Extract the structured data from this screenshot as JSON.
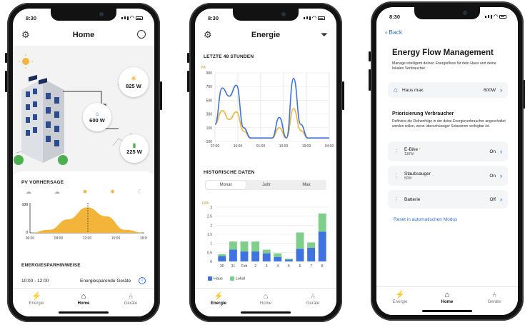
{
  "status_time": "8:30",
  "tabs": {
    "energie": "Energie",
    "home": "Home",
    "geraete": "Geräte"
  },
  "home": {
    "title": "Home",
    "bubbles": {
      "pv": "825 W",
      "house": "600 W",
      "battery": "225 W"
    },
    "pv_title": "PV VORHERSAGE",
    "pv_y_max": "100",
    "pv_y_min": "0",
    "pv_times": [
      "06:00",
      "09:00",
      "12:00",
      "15:00",
      "18:00"
    ],
    "tips_title": "ENERGIESPARHINWEISE",
    "tip_time": "10:00 - 12:00",
    "tip_text": "Energiesparende Geräte"
  },
  "energie": {
    "title": "Energie",
    "last48_title": "LETZTE 48 STUNDEN",
    "unit": "Wh",
    "y_ticks": [
      "900",
      "700",
      "500",
      "300",
      "100",
      "-100"
    ],
    "x_ticks": [
      "07:00",
      "16:00",
      "01:00",
      "10:00",
      "19:00",
      "04:00"
    ],
    "hist_title": "HISTORISCHE DATEN",
    "segments": [
      "Monat",
      "Jahr",
      "Max"
    ],
    "hist_unit": "kWh",
    "hist_y_ticks": [
      "3",
      "2.5",
      "2",
      "1.5",
      "1",
      "0.5",
      "0"
    ],
    "hist_x": [
      "30",
      "31",
      "Feb",
      "2",
      "3",
      "4",
      "5",
      "6",
      "7",
      "8"
    ],
    "legend_haus": "Haus",
    "legend_lokal": "Lokal"
  },
  "efm": {
    "back": "Back",
    "title": "Energy Flow Management",
    "intro": "Manage intelligent deinen Energiefluss für dein Haus und deine lokalen Verbraucher.",
    "haus_label": "Haus max.",
    "haus_value": "600W",
    "prio_title": "Priorisierung Verbraucher",
    "prio_desc": "Definiere die Reihenfolge in der deine Energieverbraucher angeschaltet werden sollen, wenn überschüssiger Solarstrom verfügbar ist.",
    "devices": [
      {
        "name": "E-Bike",
        "sub": "135W",
        "state": "On"
      },
      {
        "name": "Staubsauger",
        "sub": "50W",
        "state": "On"
      },
      {
        "name": "Batterie",
        "sub": "",
        "state": "Off"
      }
    ],
    "reset": "Reset in automatischen Modus"
  },
  "colors": {
    "accent": "#2a6fd6",
    "solar": "#f2b53a",
    "green": "#7fcf8a",
    "blue": "#3f74e0"
  },
  "chart_data": [
    {
      "type": "area",
      "title": "PV VORHERSAGE",
      "x": [
        "06:00",
        "09:00",
        "12:00",
        "15:00",
        "18:00"
      ],
      "ylim": [
        0,
        100
      ],
      "series": [
        {
          "values": [
            0,
            10,
            45,
            85,
            55,
            10,
            0
          ]
        }
      ]
    },
    {
      "type": "line",
      "title": "LETZTE 48 STUNDEN",
      "ylabel": "Wh",
      "ylim": [
        -100,
        900
      ],
      "x": [
        "07:00",
        "16:00",
        "01:00",
        "10:00",
        "19:00",
        "04:00"
      ],
      "series": [
        {
          "color": "#3f74e0",
          "values": [
            150,
            680,
            560,
            720,
            100,
            -50,
            -50,
            -50,
            -50,
            250,
            -50,
            820,
            150,
            -50,
            -50,
            -50,
            -50
          ]
        },
        {
          "color": "#f2b53a",
          "values": [
            150,
            350,
            220,
            330,
            50,
            -50,
            -50,
            -50,
            -50,
            100,
            -50,
            380,
            60,
            -50,
            -50,
            -50,
            -50
          ]
        }
      ]
    },
    {
      "type": "bar",
      "title": "HISTORISCHE DATEN",
      "ylabel": "kWh",
      "ylim": [
        0,
        3
      ],
      "categories": [
        "30",
        "31",
        "Feb",
        "2",
        "3",
        "4",
        "5",
        "6",
        "7",
        "8"
      ],
      "series": [
        {
          "name": "Haus",
          "values": [
            0.3,
            0.65,
            0.55,
            0.55,
            0.45,
            0.25,
            0.1,
            0.7,
            0.75,
            1.65
          ]
        },
        {
          "name": "Lokal",
          "values": [
            0.1,
            0.45,
            0.55,
            0.55,
            0.2,
            0.2,
            0.05,
            0.9,
            0.3,
            1.0
          ]
        }
      ]
    }
  ]
}
